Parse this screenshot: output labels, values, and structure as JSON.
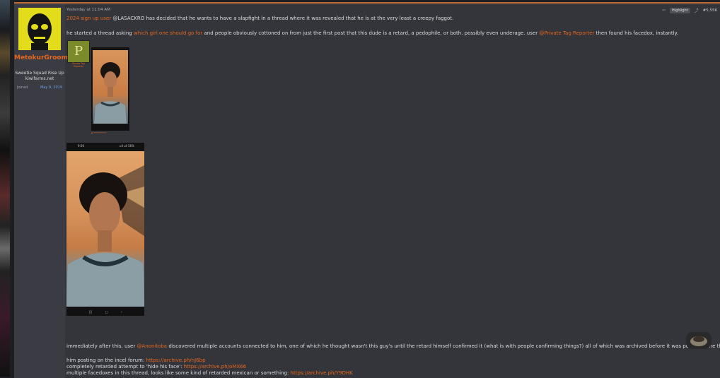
{
  "user": {
    "name": "MetokurGroomedMe",
    "title": "Sweetie Squad Rise Up\nkiwifarms.net",
    "joined_label": "Joined",
    "joined_value": "May 9, 2019"
  },
  "post": {
    "date": "Yesterday at 11:04 AM",
    "highlight_label": "Highlight",
    "post_number": "#5,556",
    "p1_link": "2024 sign up user",
    "p1_text": " @LASACKRO has decided that he wants to have a slapfight in a thread where it was revealed that he is at the very least a creepy faggot.",
    "p2_a": "he started a thread asking ",
    "p2_link1": "which girl one should go for",
    "p2_b": " and people obviously cottoned on from just the first post that this dude is a retard, a pedophile, or both. possibly even underage. user ",
    "p2_link2": "@Private Tag Reporter",
    "p2_c": " then found his facedox, instantly.",
    "embed_avatar_letter": "P",
    "embed_name": "Private Tag Reporter",
    "p3_a": "immediately after this, user ",
    "p3_link": "@Anonitoba",
    "p3_b": " discovered multiple accounts connected to him, one of which he thought wasn't this guy's until the retard himself confirmed it (what is with people confirming things?) all of which was archived before it was posted in the thread.",
    "l1_text": "him posting on the incel forum: ",
    "l1_link": "https://archive.ph/nJ6bp",
    "l2_text": "completely retarded attempt to 'hide his face': ",
    "l2_link": "https://archive.ph/oMX66",
    "l3_text": "multiple facedoxes in this thread, looks like some kind of retarded mexican or something: ",
    "l3_link": "https://archive.ph/Y9DHK"
  },
  "photo": {
    "time": "9:06",
    "status_right": "ull ull 56%"
  },
  "colors": {
    "accent": "#e5661c",
    "link_blue": "#6aa6e8",
    "post_bg": "#34353b",
    "usercol_bg": "#3b3c43"
  }
}
